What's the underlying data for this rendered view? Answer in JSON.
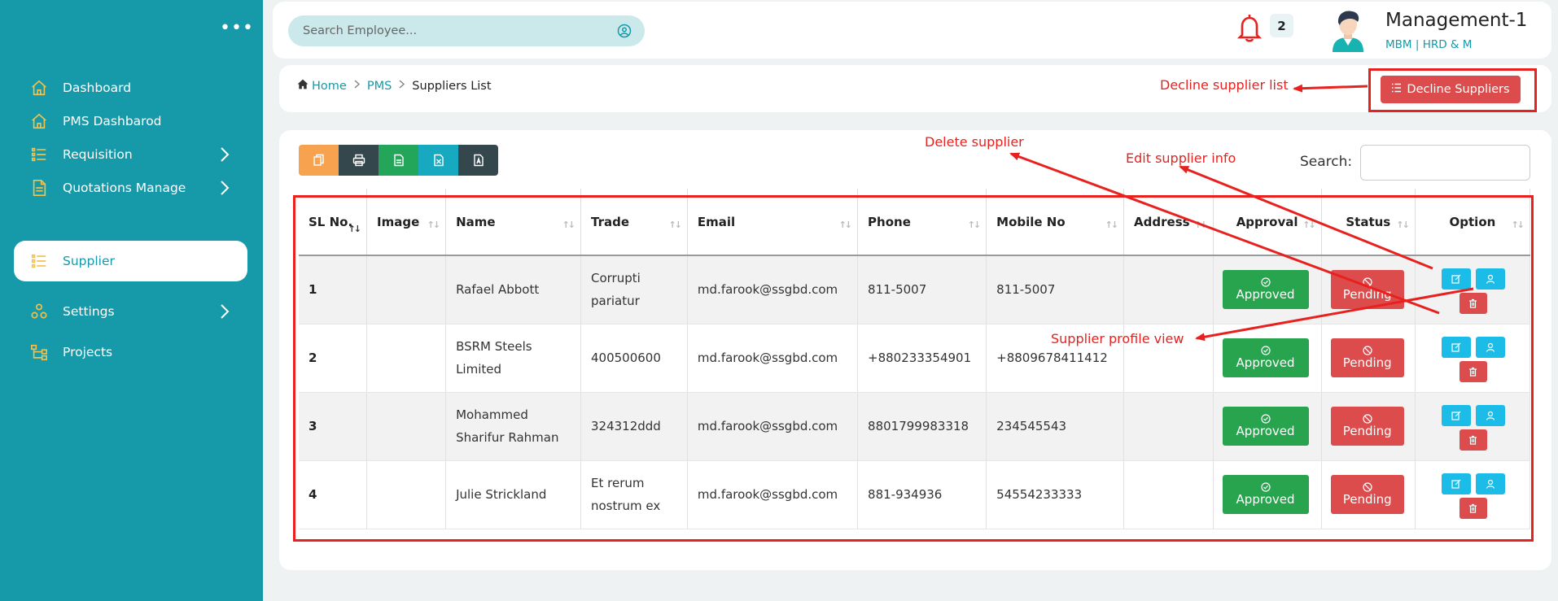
{
  "sidebar": {
    "items": [
      {
        "label": "Dashboard",
        "icon": "home-icon"
      },
      {
        "label": "PMS Dashbarod",
        "icon": "home-icon"
      },
      {
        "label": "Requisition",
        "icon": "list-icon"
      },
      {
        "label": "Quotations Manage",
        "icon": "document-icon"
      },
      {
        "label": "Supplier",
        "icon": "list-icon"
      },
      {
        "label": "Settings",
        "icon": "users-icon"
      },
      {
        "label": "Projects",
        "icon": "hierarchy-icon"
      }
    ]
  },
  "header": {
    "search_placeholder": "Search Employee...",
    "notification_count": "2",
    "user_name": "Management-1",
    "user_dept": "MBM  | HRD & M"
  },
  "breadcrumb": {
    "home": "Home",
    "pms": "PMS",
    "current": "Suppliers List",
    "decline_label": "Decline Suppliers"
  },
  "table": {
    "search_label": "Search:",
    "columns": [
      "SL No.",
      "Image",
      "Name",
      "Trade",
      "Email",
      "Phone",
      "Mobile No",
      "Address",
      "Approval",
      "Status",
      "Option"
    ],
    "rows": [
      {
        "sl": "1",
        "name": "Rafael Abbott",
        "trade": "Corrupti pariatur",
        "email": "md.farook@ssgbd.com",
        "phone": "811-5007",
        "mobile": "811-5007",
        "address": "",
        "approval": "Approved",
        "status": "Pending"
      },
      {
        "sl": "2",
        "name": "BSRM Steels Limited",
        "trade": "400500600",
        "email": "md.farook@ssgbd.com",
        "phone": "+880233354901",
        "mobile": "+8809678411412",
        "address": "",
        "approval": "Approved",
        "status": "Pending"
      },
      {
        "sl": "3",
        "name": "Mohammed Sharifur Rahman",
        "trade": "324312ddd",
        "email": "md.farook@ssgbd.com",
        "phone": "8801799983318",
        "mobile": "234545543",
        "address": "",
        "approval": "Approved",
        "status": "Pending"
      },
      {
        "sl": "4",
        "name": "Julie Strickland",
        "trade": "Et rerum nostrum ex",
        "email": "md.farook@ssgbd.com",
        "phone": "881-934936",
        "mobile": "54554233333",
        "address": "",
        "approval": "Approved",
        "status": "Pending"
      }
    ]
  },
  "annotations": {
    "decline": "Decline supplier list",
    "delete": "Delete supplier",
    "edit": "Edit supplier info",
    "profile": "Supplier profile view"
  },
  "colors": {
    "sidebar": "#1699a8",
    "approved": "#28a44f",
    "pending": "#dc4c4c",
    "action": "#1bbde8",
    "annotation": "#e8211f"
  }
}
